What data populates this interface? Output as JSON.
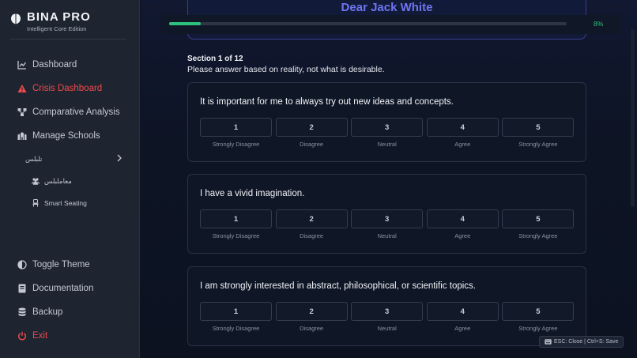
{
  "brand": {
    "title": "BINA PRO",
    "subtitle": "Intelligent Core Edition"
  },
  "nav": {
    "dashboard": "Dashboard",
    "crisis": "Crisis Dashboard",
    "comparative": "Comparative Analysis",
    "schools": "Manage Schools",
    "students": "تلبلس",
    "teachers": "معاملبلس",
    "seating": "Smart Seating",
    "theme": "Toggle Theme",
    "docs": "Documentation",
    "backup": "Backup",
    "exit": "Exit"
  },
  "header": {
    "greeting": "Dear Jack White"
  },
  "progress": {
    "percent": 8,
    "label": "8%"
  },
  "section": {
    "title": "Section 1 of 12",
    "instruction": "Please answer based on reality, not what is desirable."
  },
  "scale": [
    {
      "value": "1",
      "label": "Strongly Disagree"
    },
    {
      "value": "2",
      "label": "Disagree"
    },
    {
      "value": "3",
      "label": "Neutral"
    },
    {
      "value": "4",
      "label": "Agree"
    },
    {
      "value": "5",
      "label": "Strongly Agree"
    }
  ],
  "questions": [
    {
      "text": "It is important for me to always try out new ideas and concepts."
    },
    {
      "text": "I have a vivid imagination."
    },
    {
      "text": "I am strongly interested in abstract, philosophical, or scientific topics."
    }
  ],
  "shortcut_hint": "ESC: Close | Ctrl+S: Save",
  "colors": {
    "accent": "#6f75f0",
    "danger": "#ef4b4b",
    "success": "#2ec27e"
  }
}
